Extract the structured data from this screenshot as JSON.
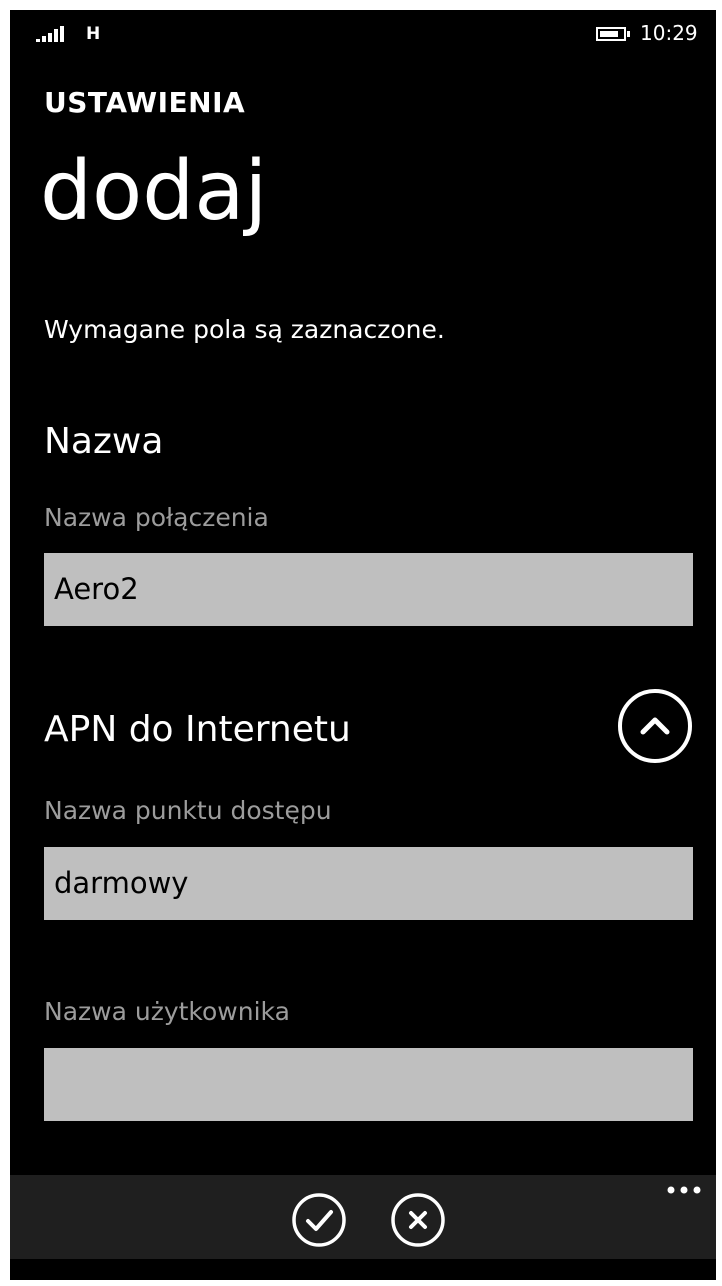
{
  "status_bar": {
    "signal_icon": "signal-strength-icon",
    "network_type": "H",
    "battery_icon": "battery-icon",
    "time": "10:29"
  },
  "header": {
    "app_title": "USTAWIENIA",
    "page_title": "dodaj"
  },
  "form": {
    "required_note": "Wymagane pola są zaznaczone.",
    "section_name": {
      "heading": "Nazwa",
      "connection_name_label": "Nazwa połączenia",
      "connection_name_value": "Aero2"
    },
    "section_apn": {
      "heading": "APN do Internetu",
      "collapse_icon": "chevron-up-icon",
      "access_point_label": "Nazwa punktu dostępu",
      "access_point_value": "darmowy",
      "username_label": "Nazwa użytkownika",
      "username_value": ""
    }
  },
  "app_bar": {
    "buttons": [
      {
        "icon": "check-icon",
        "action": "save"
      },
      {
        "icon": "close-icon",
        "action": "cancel"
      }
    ],
    "more_icon": "more-dots-icon"
  },
  "colors": {
    "background": "#000000",
    "foreground": "#ffffff",
    "label": "#9c9c9c",
    "input_background": "#bfbfbf",
    "app_bar": "#1f1f1f"
  }
}
